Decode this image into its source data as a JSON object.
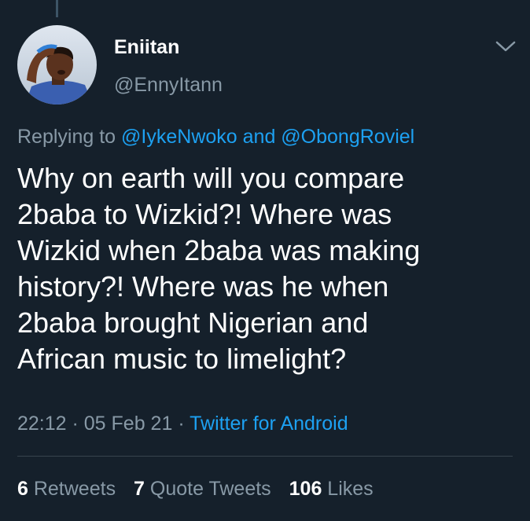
{
  "author": {
    "display_name": "Eniitan",
    "handle": "@EnnyItann"
  },
  "reply_context": {
    "prefix": "Replying to ",
    "mention_1": "@IykeNwoko",
    "joiner": " and ",
    "mention_2": "@ObongRoviel"
  },
  "tweet": {
    "lines": [
      "Why on earth will you compare",
      "2baba to Wizkid?! Where was",
      "Wizkid when 2baba was making",
      "history?! Where was he when",
      "2baba brought Nigerian and",
      "African music to limelight?"
    ]
  },
  "meta": {
    "time": "22:12",
    "separator_1": " · ",
    "date": "05 Feb 21",
    "separator_2": " · ",
    "source": "Twitter for Android"
  },
  "stats": {
    "retweets": {
      "count": "6",
      "label": " Retweets"
    },
    "quote_tweets": {
      "count": "7",
      "label": " Quote Tweets"
    },
    "likes": {
      "count": "106",
      "label": " Likes"
    }
  },
  "icons": {
    "more_menu": "chevron-down-icon"
  },
  "colors": {
    "background": "#15202b",
    "text": "#ffffff",
    "muted": "#8899a6",
    "accent": "#1da1f2",
    "divider": "#38444d"
  }
}
